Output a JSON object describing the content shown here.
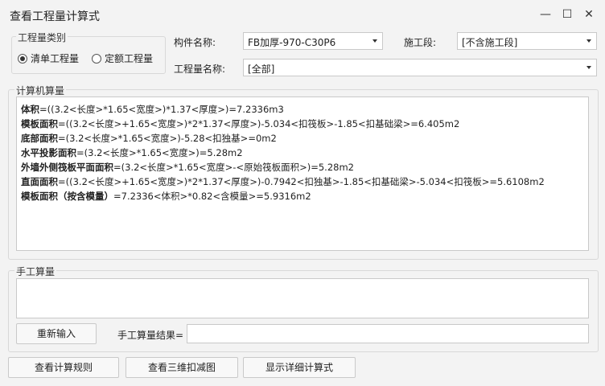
{
  "window": {
    "title": "查看工程量计算式",
    "minimize_glyph": "—",
    "maximize_glyph": "☐",
    "close_glyph": "✕"
  },
  "quantity_type": {
    "legend": "工程量类别",
    "options": [
      {
        "label": "清单工程量",
        "selected": true
      },
      {
        "label": "定额工程量",
        "selected": false
      }
    ]
  },
  "filters": {
    "component_label": "构件名称:",
    "component_value": "FB加厚-970-C30P6",
    "stage_label": "施工段:",
    "stage_value": "[不含施工段]",
    "quantity_name_label": "工程量名称:",
    "quantity_name_value": "[全部]"
  },
  "computer_calc": {
    "legend": "计算机算量",
    "lines": [
      {
        "name": "体积",
        "expr": "=((3.2<长度>*1.65<宽度>)*1.37<厚度>)=7.2336m3"
      },
      {
        "name": "模板面积",
        "expr": "=((3.2<长度>+1.65<宽度>)*2*1.37<厚度>)-5.034<扣筏板>-1.85<扣基础梁>=6.405m2"
      },
      {
        "name": "底部面积",
        "expr": "=(3.2<长度>*1.65<宽度>)-5.28<扣独基>=0m2"
      },
      {
        "name": "水平投影面积",
        "expr": "=(3.2<长度>*1.65<宽度>)=5.28m2"
      },
      {
        "name": "外墙外侧筏板平面面积",
        "expr": "=(3.2<长度>*1.65<宽度>-<原始筏板面积>)=5.28m2"
      },
      {
        "name": "直面面积",
        "expr": "=((3.2<长度>+1.65<宽度>)*2*1.37<厚度>)-0.7942<扣独基>-1.85<扣基础梁>-5.034<扣筏板>=5.6108m2"
      },
      {
        "name": "模板面积（按含模量）",
        "expr": "=7.2336<体积>*0.82<含模量>=5.9316m2"
      }
    ]
  },
  "manual_calc": {
    "legend": "手工算量",
    "reenter_button": "重新输入",
    "result_label": "手工算量结果=",
    "result_value": ""
  },
  "footer": {
    "rules_button": "查看计算规则",
    "view3d_button": "查看三维扣减图",
    "detail_button": "显示详细计算式"
  }
}
